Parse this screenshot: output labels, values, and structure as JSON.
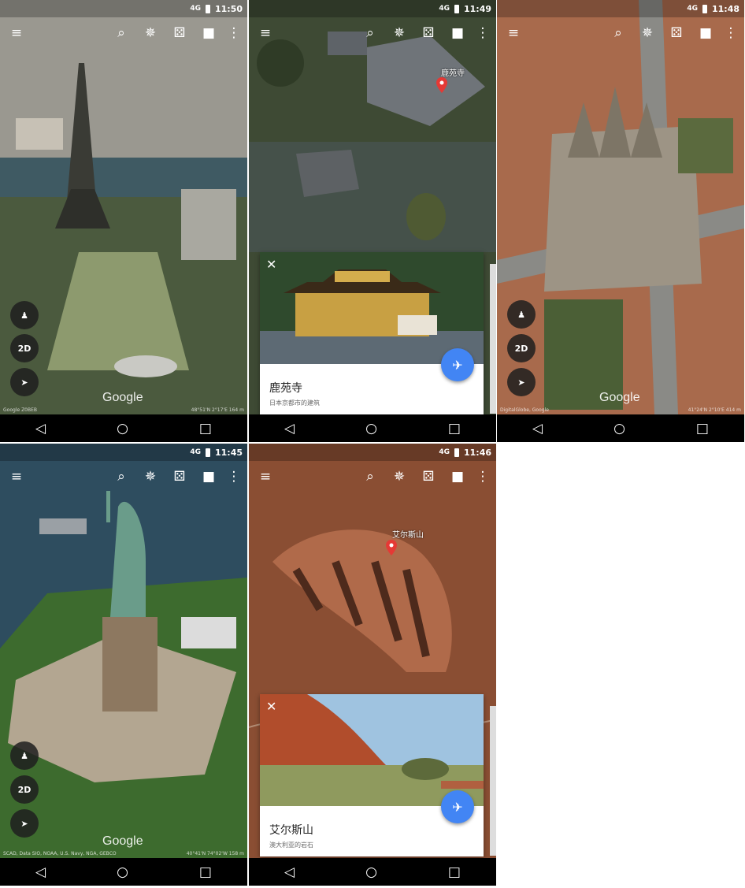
{
  "screens": [
    {
      "time": "11:50",
      "google": "Google",
      "attrib_left": "Google Z0BEB",
      "attrib_right": "48°51'N 2°17'E 164 m"
    },
    {
      "time": "11:49",
      "place_label": "鹿苑寺",
      "card": {
        "title": "鹿苑寺",
        "subtitle": "日本京都市的建筑"
      }
    },
    {
      "time": "11:48",
      "google": "Google",
      "attrib_left": "DigitalGlobe, Google",
      "attrib_right": "41°24'N 2°10'E 414 m"
    },
    {
      "time": "11:45",
      "google": "Google",
      "attrib_left": "SCAD, Data SIO, NOAA, U.S. Navy, NGA, GEBCO",
      "attrib_right": "40°41'N 74°02'W 158 m"
    },
    {
      "time": "11:46",
      "place_label": "艾尔斯山",
      "card": {
        "title": "艾尔斯山",
        "subtitle": "澳大利亚的岩石"
      }
    }
  ],
  "common": {
    "signal": "4G",
    "toolbar_icons": [
      "menu-icon",
      "search-icon",
      "voyager-icon",
      "dice-icon",
      "camera-icon",
      "more-icon"
    ],
    "fab_2d": "2D",
    "colors": {
      "share": "#4285f4",
      "pin": "#e53935"
    }
  }
}
